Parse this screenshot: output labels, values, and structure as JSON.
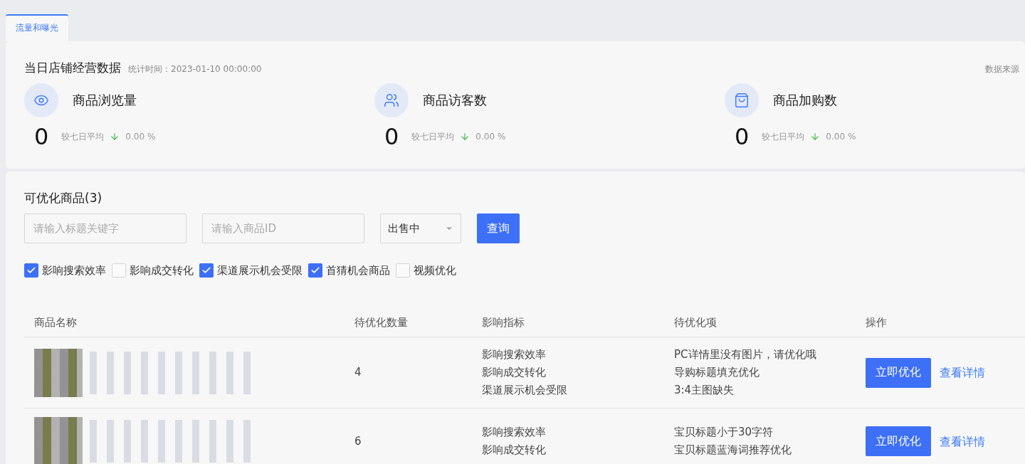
{
  "tabs": [
    {
      "label": "流量和曝光",
      "selected": true
    }
  ],
  "overview": {
    "title": "当日店铺经营数据",
    "stat_time": "统计时间：2023-01-10 00:00:00",
    "source": "数据来源",
    "metrics": [
      {
        "label": "商品浏览量",
        "value": "0",
        "compare": "较七日平均",
        "change": "0.00 %"
      },
      {
        "label": "商品访客数",
        "value": "0",
        "compare": "较七日平均",
        "change": "0.00 %"
      },
      {
        "label": "商品加购数",
        "value": "0",
        "compare": "较七日平均",
        "change": "0.00 %"
      }
    ]
  },
  "products": {
    "title": "可优化商品(3)",
    "keyword_placeholder": "请输入标题关键字",
    "id_placeholder": "请输入商品ID",
    "status": "出售中",
    "query_button": "查询",
    "filters": [
      {
        "label": "影响搜索效率",
        "checked": true
      },
      {
        "label": "影响成交转化",
        "checked": false
      },
      {
        "label": "渠道展示机会受限",
        "checked": true
      },
      {
        "label": "首猜机会商品",
        "checked": true
      },
      {
        "label": "视频优化",
        "checked": false
      }
    ],
    "columns": [
      "商品名称",
      "待优化数量",
      "影响指标",
      "待优化项",
      "操作"
    ],
    "rows": [
      {
        "count": "4",
        "metrics": [
          "影响搜索效率",
          "影响成交转化",
          "渠道展示机会受限"
        ],
        "items": [
          "PC详情里没有图片，请优化哦",
          "导购标题填充优化",
          "3:4主图缺失"
        ],
        "optimize": "立即优化",
        "details": "查看详情"
      },
      {
        "count": "6",
        "metrics": [
          "影响搜索效率",
          "影响成交转化"
        ],
        "items": [
          "宝贝标题小于30字符",
          "宝贝标题蓝海词推荐优化"
        ],
        "optimize": "立即优化",
        "details": "查看详情"
      }
    ]
  }
}
